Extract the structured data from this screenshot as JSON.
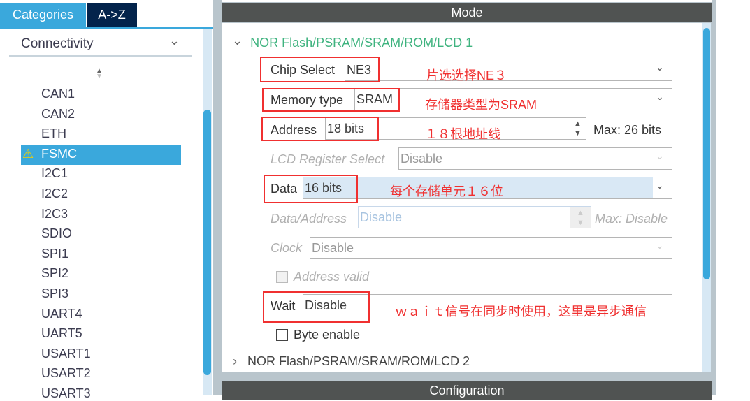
{
  "left": {
    "tabs": [
      "Categories",
      "A->Z"
    ],
    "category": "Connectivity",
    "items": [
      "CAN1",
      "CAN2",
      "ETH",
      "FSMC",
      "I2C1",
      "I2C2",
      "I2C3",
      "SDIO",
      "SPI1",
      "SPI2",
      "SPI3",
      "UART4",
      "UART5",
      "USART1",
      "USART2",
      "USART3"
    ],
    "selected": "FSMC"
  },
  "mode": {
    "title": "Mode",
    "section1": "NOR Flash/PSRAM/SRAM/ROM/LCD 1",
    "section2": "NOR Flash/PSRAM/SRAM/ROM/LCD 2",
    "fields": {
      "chip_select": {
        "label": "Chip Select",
        "value": "NE3"
      },
      "memory_type": {
        "label": "Memory type",
        "value": "SRAM"
      },
      "address": {
        "label": "Address",
        "value": "18 bits",
        "max": "Max: 26 bits"
      },
      "lcd_register": {
        "label": "LCD Register Select",
        "value": "Disable"
      },
      "data": {
        "label": "Data",
        "value": "16 bits"
      },
      "data_address": {
        "label": "Data/Address",
        "value": "Disable",
        "max": "Max: Disable"
      },
      "clock": {
        "label": "Clock",
        "value": "Disable"
      },
      "address_valid": {
        "label": "Address valid",
        "checked": false
      },
      "wait": {
        "label": "Wait",
        "value": "Disable"
      },
      "byte_enable": {
        "label": "Byte enable",
        "checked": false
      }
    }
  },
  "config": {
    "title": "Configuration"
  },
  "annotations": {
    "chip": "片选选择NE３",
    "mem": "存储器类型为SRAM",
    "addr": "１８根地址线",
    "data": "每个存储单元１６位",
    "wait": "ｗａｉｔ信号在同步时使用，这里是异步通信"
  },
  "colors": {
    "accent": "#3aa8dc",
    "header": "#505352",
    "selected": "#3aa8dc",
    "annotation": "#f03030",
    "section": "#3fb37f"
  }
}
